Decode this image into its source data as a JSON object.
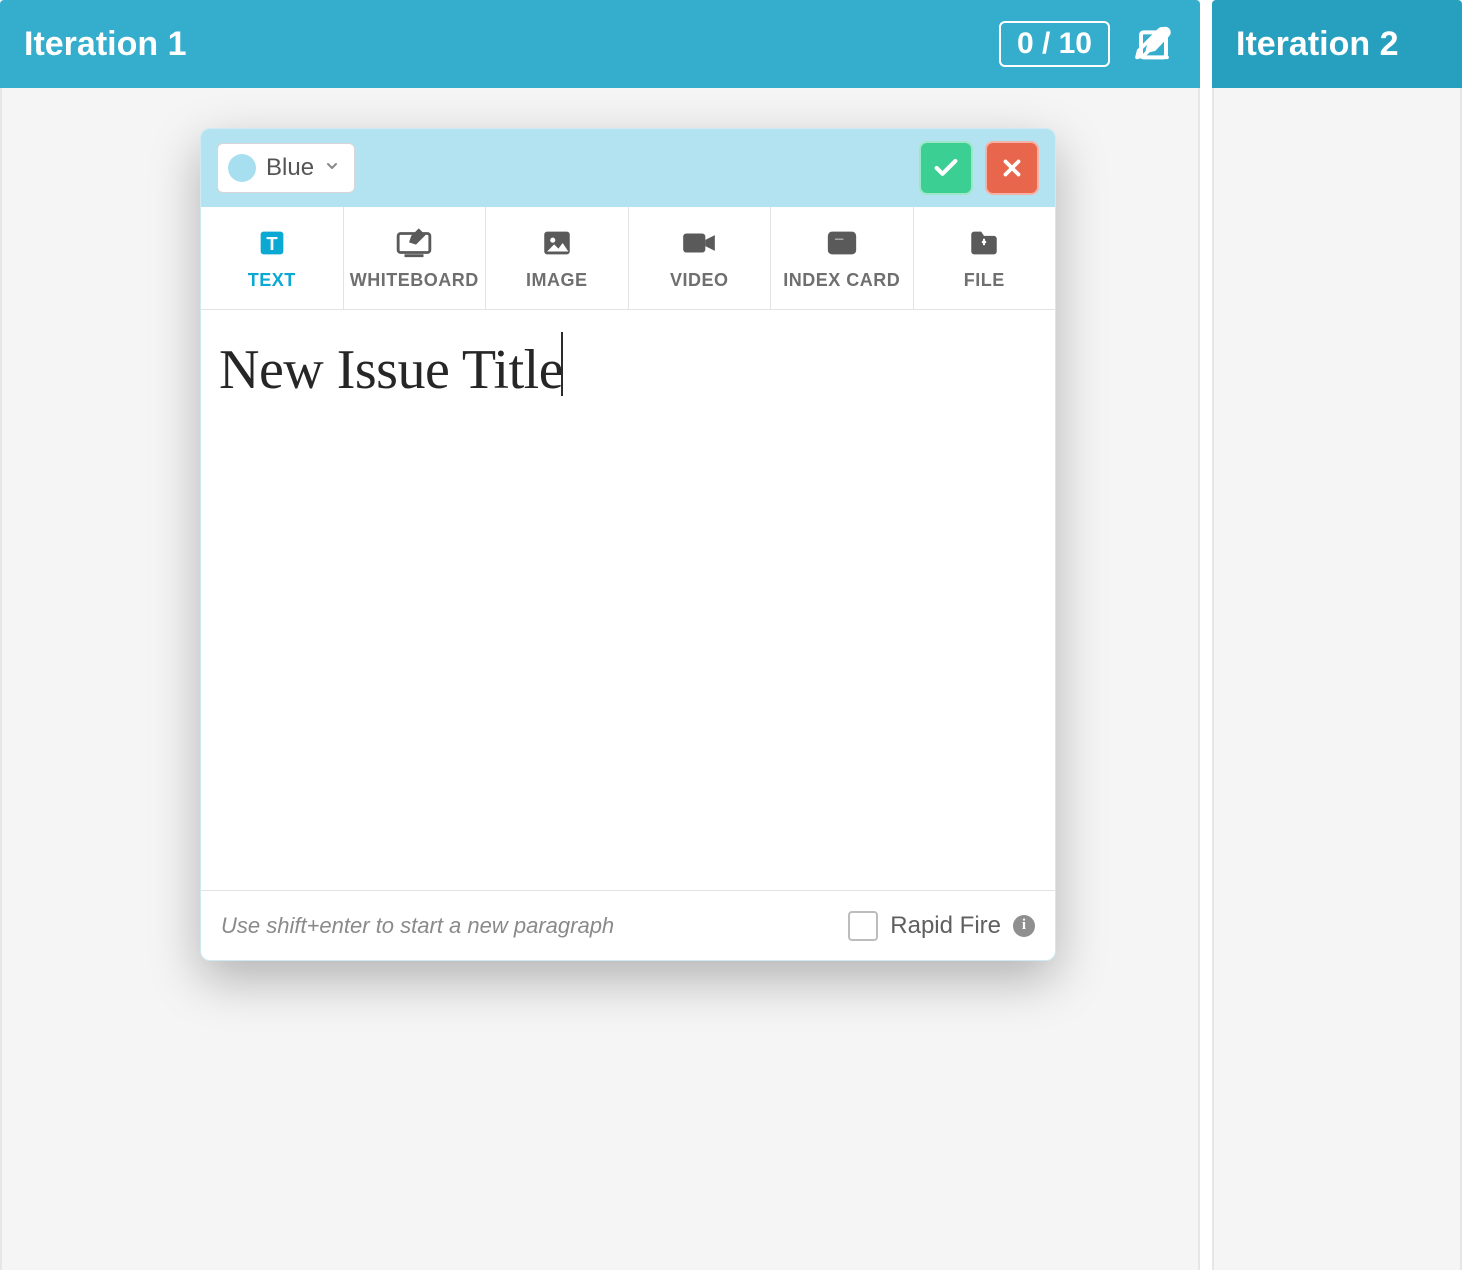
{
  "columns": [
    {
      "title": "Iteration 1",
      "counter": "0 / 10"
    },
    {
      "title": "Iteration 2"
    }
  ],
  "card": {
    "color_selector": {
      "label": "Blue"
    },
    "tabs": [
      {
        "label": "TEXT",
        "icon": "text-icon",
        "active": true
      },
      {
        "label": "WHITEBOARD",
        "icon": "whiteboard-icon",
        "active": false
      },
      {
        "label": "IMAGE",
        "icon": "image-icon",
        "active": false
      },
      {
        "label": "VIDEO",
        "icon": "video-icon",
        "active": false
      },
      {
        "label": "INDEX CARD",
        "icon": "indexcard-icon",
        "active": false
      },
      {
        "label": "FILE",
        "icon": "file-icon",
        "active": false
      }
    ],
    "title_value": "New Issue Title",
    "footer_hint": "Use shift+enter to start a new paragraph",
    "rapid_fire": {
      "label": "Rapid Fire",
      "checked": false
    }
  },
  "colors": {
    "header_bg": "#35aecd",
    "card_header_bg": "#b3e3f0",
    "confirm": "#3bcf93",
    "cancel": "#e8674c",
    "active_tab": "#0aa8d3"
  }
}
